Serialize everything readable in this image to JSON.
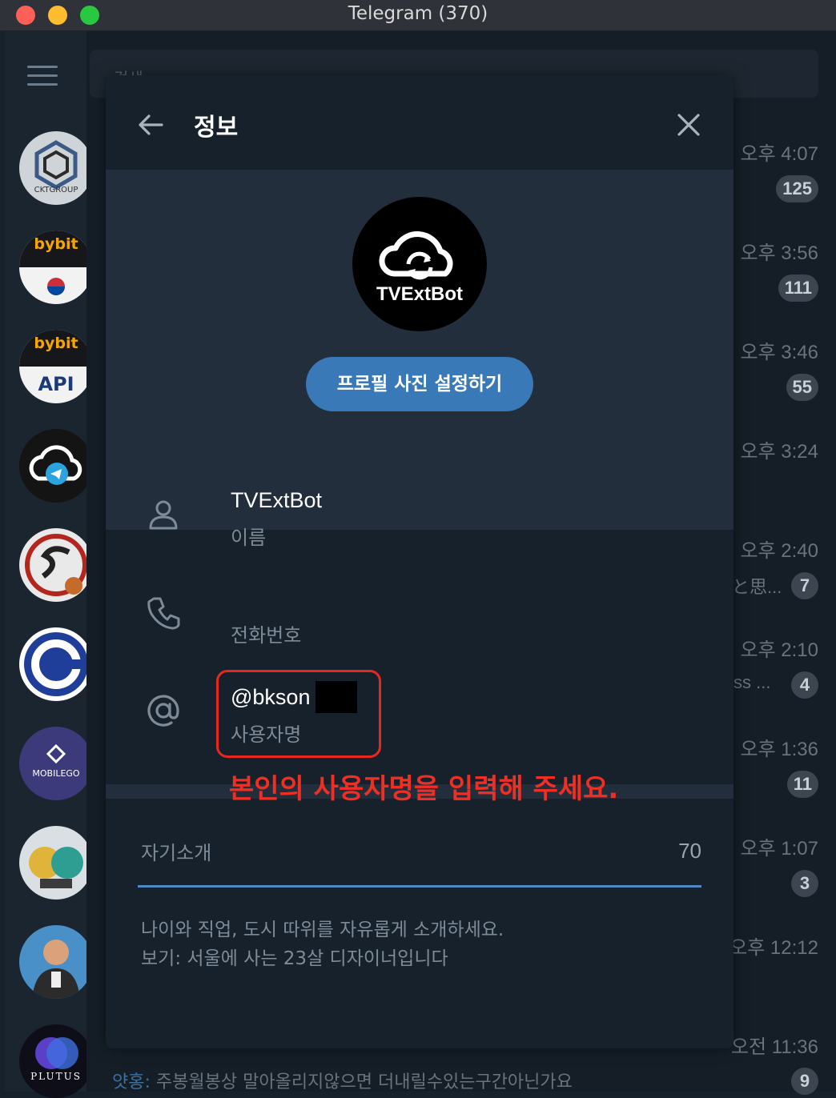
{
  "window": {
    "title": "Telegram (370)"
  },
  "search": {
    "placeholder": "검색"
  },
  "sidebar": {
    "avatars": [
      {
        "name": "CKT GROUP",
        "text": "CKTGROUP"
      },
      {
        "name": "bybit korea",
        "text": "bybit"
      },
      {
        "name": "bybit API",
        "text": "bybit",
        "sub": "API"
      },
      {
        "name": "cloud telegram"
      },
      {
        "name": "SC JP"
      },
      {
        "name": "circle logo"
      },
      {
        "name": "MOBILEGO",
        "text": "MOBILEGO"
      },
      {
        "name": "monkeys"
      },
      {
        "name": "man with suit"
      },
      {
        "name": "PLUTUS",
        "text": "PLUTUS"
      }
    ]
  },
  "chat_list": {
    "times": [
      "오후 4:07",
      "오후 3:56",
      "오후 3:46",
      "오후 3:24",
      "오후 2:40",
      "오후 2:10",
      "오후 1:36",
      "오후 1:07",
      "오후 12:12",
      "오전 11:36"
    ],
    "badges": [
      "125",
      "111",
      "55",
      "7",
      "4",
      "11",
      "3",
      "9"
    ],
    "snippets": [
      "と思...",
      "ss ..."
    ],
    "bottom_sender": "얏홍:",
    "bottom_message": "주봉월봉상 말아올리지않으면 더내릴수있는구간아닌가요"
  },
  "modal": {
    "title": "정보",
    "avatar_text": "TVExtBot",
    "set_photo_label": "프로필 사진 설정하기",
    "name_value": "TVExtBot",
    "name_label": "이름",
    "phone_label": "전화번호",
    "username_value": "@bkson",
    "username_label": "사용자명",
    "annotation": "본인의 사용자명을 입력해 주세요.",
    "bio_label": "자기소개",
    "bio_counter": "70",
    "bio_help_1": "나이와 직업, 도시 따위를 자유롭게 소개하세요.",
    "bio_help_2": "보기: 서울에 사는 23살 디자이너입니다"
  },
  "colors": {
    "accent": "#3a79b8",
    "annotation_red": "#e8271f",
    "background": "#17212b"
  }
}
